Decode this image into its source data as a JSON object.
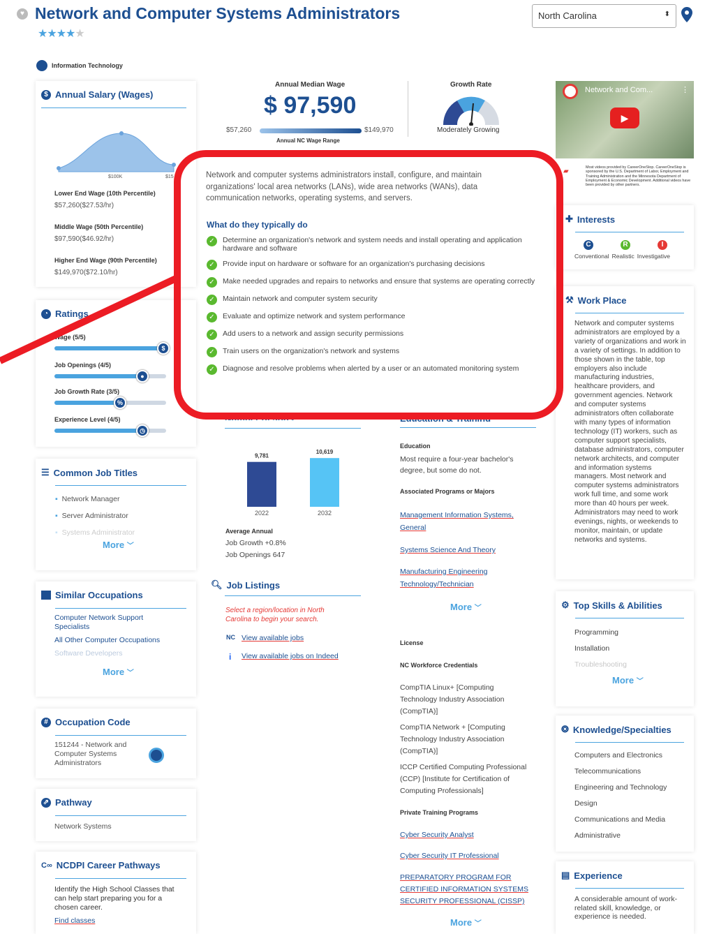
{
  "header": {
    "title": "Network and Computer Systems Administrators",
    "state": "North Carolina",
    "rating_stars": 4,
    "category": "Information Technology"
  },
  "salary": {
    "title": "Annual Salary (Wages)",
    "axis": [
      "$100K",
      "$15"
    ],
    "rows": [
      {
        "label": "Lower End Wage (10th Percentile)",
        "value": "$57,260($27.53/hr)"
      },
      {
        "label": "Middle Wage (50th Percentile)",
        "value": "$97,590($46.92/hr)"
      },
      {
        "label": "Higher End Wage (90th Percentile)",
        "value": "$149,970($72.10/hr)"
      }
    ]
  },
  "ratings": {
    "title": "Ratings",
    "items": [
      {
        "label": "Wage (5/5)",
        "value": 5,
        "icon": "$"
      },
      {
        "label": "Job Openings (4/5)",
        "value": 4,
        "icon": "person"
      },
      {
        "label": "Job Growth Rate (3/5)",
        "value": 3,
        "icon": "%"
      },
      {
        "label": "Experience Level (4/5)",
        "value": 4,
        "icon": "clock"
      }
    ]
  },
  "job_titles": {
    "title": "Common Job Titles",
    "items": [
      "Network Manager",
      "Server Administrator",
      "Systems Administrator"
    ],
    "more": "More"
  },
  "similar": {
    "title": "Similar Occupations",
    "items": [
      "Computer Network Support Specialists",
      "All Other Computer Occupations",
      "Software Developers"
    ],
    "more": "More"
  },
  "occ_code": {
    "title": "Occupation Code",
    "text": "151244 - Network and Computer Systems Administrators"
  },
  "pathway": {
    "title": "Pathway",
    "text": "Network Systems"
  },
  "ncdpi": {
    "title": "NCDPI Career Pathways",
    "text": "Identify the High School Classes that can help start preparing you for a chosen career.",
    "link": "Find classes"
  },
  "wage": {
    "label": "Annual Median Wage",
    "value": "$ 97,590",
    "low": "$57,260",
    "high": "$149,970",
    "range_label": "Annual NC Wage Range"
  },
  "growth": {
    "label": "Growth Rate",
    "value": "Moderately Growing"
  },
  "video": {
    "title": "Network and Com...",
    "credit": "Most videos provided by CareerOneStop. CareerOneStop is sponsored by the U.S. Department of Labor, Employment and Training Administration and the Minnesota Department of Employment & Economic Development. Additional videos have been provided by other partners."
  },
  "description": {
    "text": "Network and computer systems administrators install, configure, and maintain organizations' local area networks (LANs), wide area networks (WANs), data communication networks, operating systems, and servers.",
    "tasks_title": "What do they typically do",
    "tasks": [
      "Determine an organization's network and system needs and install operating and application hardware and software",
      "Provide input on hardware or software for an organization's purchasing decisions",
      "Make needed upgrades and repairs to networks and ensure that systems are operating correctly",
      "Maintain network and computer system security",
      "Evaluate and optimize network and system performance",
      "Add users to a network and assign security permissions",
      "Train users on the organization's network and systems",
      "Diagnose and resolve problems when alerted by a user or an automated monitoring system"
    ]
  },
  "jobs": {
    "title": "Number of Jobs",
    "avg_label": "Average Annual",
    "growth": "Job Growth +0.8%",
    "openings": "Job Openings 647"
  },
  "chart_data": {
    "type": "bar",
    "categories": [
      "2022",
      "2032"
    ],
    "values": [
      9781,
      10619
    ],
    "value_labels": [
      "9,781",
      "10,619"
    ],
    "title": "Number of Jobs",
    "colors": [
      "#2e4a94",
      "#56c4f5"
    ]
  },
  "listings": {
    "title": "Job Listings",
    "prompt": "Select a region/location in North Carolina to begin your search.",
    "link1": "View available jobs",
    "link2": "View available jobs on Indeed"
  },
  "education": {
    "title": "Education & Training",
    "edu_label": "Education",
    "edu_text": "Most require a four-year bachelor's degree, but some do not.",
    "programs_label": "Associated Programs or Majors",
    "programs": [
      "Management Information Systems, General",
      "Systems Science And Theory",
      "Manufacturing Engineering Technology/Technician"
    ],
    "more": "More",
    "license": "License",
    "cred_label": "NC Workforce Credentials",
    "creds": [
      "CompTIA Linux+ [Computing Technology Industry Association (CompTIA)]",
      "CompTIA Network + [Computing Technology Industry Association (CompTIA)]",
      "ICCP Certified Computing Professional (CCP) [Institute for Certification of Computing Professionals]"
    ],
    "private_label": "Private Training Programs",
    "private": [
      "Cyber Security Analyst",
      "Cyber Security IT Professional",
      "PREPARATORY PROGRAM FOR CERTIFIED INFORMATION SYSTEMS SECURITY PROFESSIONAL (CISSP)"
    ],
    "more2": "More"
  },
  "interests": {
    "title": "Interests",
    "items": [
      {
        "letter": "C",
        "label": "Conventional",
        "color": "#1d4f91"
      },
      {
        "letter": "R",
        "label": "Realistic",
        "color": "#5ab92f"
      },
      {
        "letter": "I",
        "label": "Investigative",
        "color": "#e53935"
      }
    ]
  },
  "workplace": {
    "title": "Work Place",
    "text": "Network and computer systems administrators are employed by a variety of organizations and work in a variety of settings. In addition to those shown in the table, top employers also include manufacturing industries, healthcare providers, and government agencies. Network and computer systems administrators often collaborate with many types of information technology (IT) workers, such as computer support specialists, database administrators, computer network architects, and computer and information systems managers. Most network and computer systems administrators work full time, and some work more than 40 hours per week. Administrators may need to work evenings, nights, or weekends to monitor, maintain, or update networks and systems."
  },
  "skills": {
    "title": "Top Skills & Abilities",
    "items": [
      "Programming",
      "Installation",
      "Troubleshooting"
    ],
    "more": "More"
  },
  "knowledge": {
    "title": "Knowledge/Specialties",
    "items": [
      "Computers and Electronics",
      "Telecommunications",
      "Engineering and Technology",
      "Design",
      "Communications and Media",
      "Administrative"
    ]
  },
  "experience": {
    "title": "Experience",
    "text": "A considerable amount of work-related skill, knowledge, or experience is needed."
  }
}
